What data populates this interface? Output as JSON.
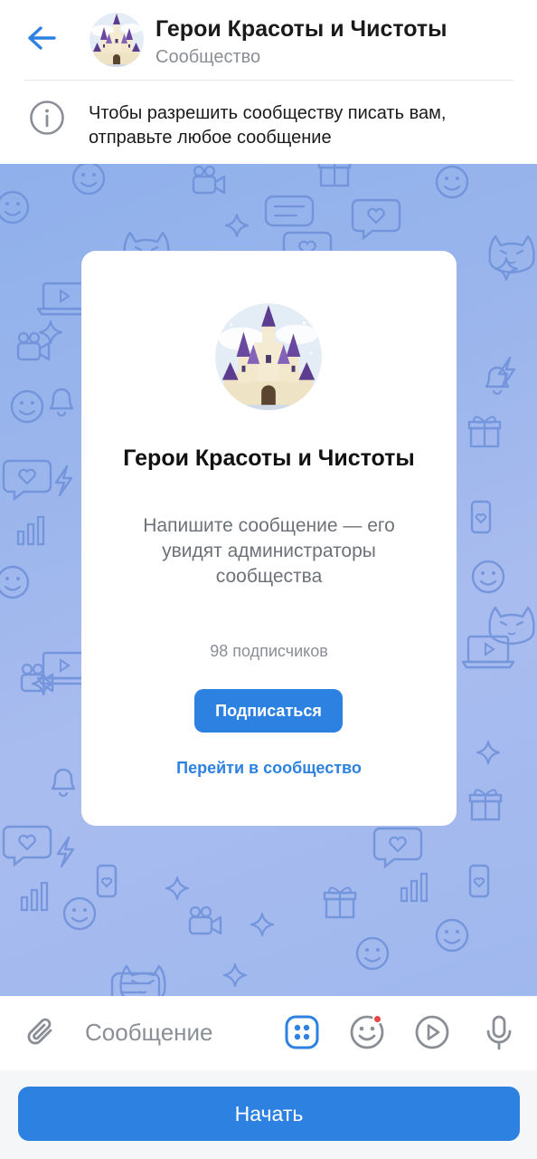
{
  "header": {
    "title": "Герои Красоты и Чистоты",
    "subtitle": "Сообщество",
    "back_icon": "arrow-left-icon",
    "accent": "#2d81e0"
  },
  "info_banner": {
    "icon": "info-icon",
    "text": "Чтобы разрешить сообществу писать вам, отправьте любое сообщение"
  },
  "card": {
    "title": "Герои Красоты и Чистоты",
    "description": "Напишите сообщение — его увидят администраторы сообщества",
    "subscribers": "98 подписчиков",
    "subscribe_label": "Подписаться",
    "goto_label": "Перейти в сообщество"
  },
  "composer": {
    "placeholder": "Сообщение",
    "icons": [
      "paperclip-icon",
      "apps-icon",
      "sticker-icon",
      "play-icon",
      "microphone-icon"
    ],
    "badge_color": "#e64646"
  },
  "bottom": {
    "start_label": "Начать"
  }
}
